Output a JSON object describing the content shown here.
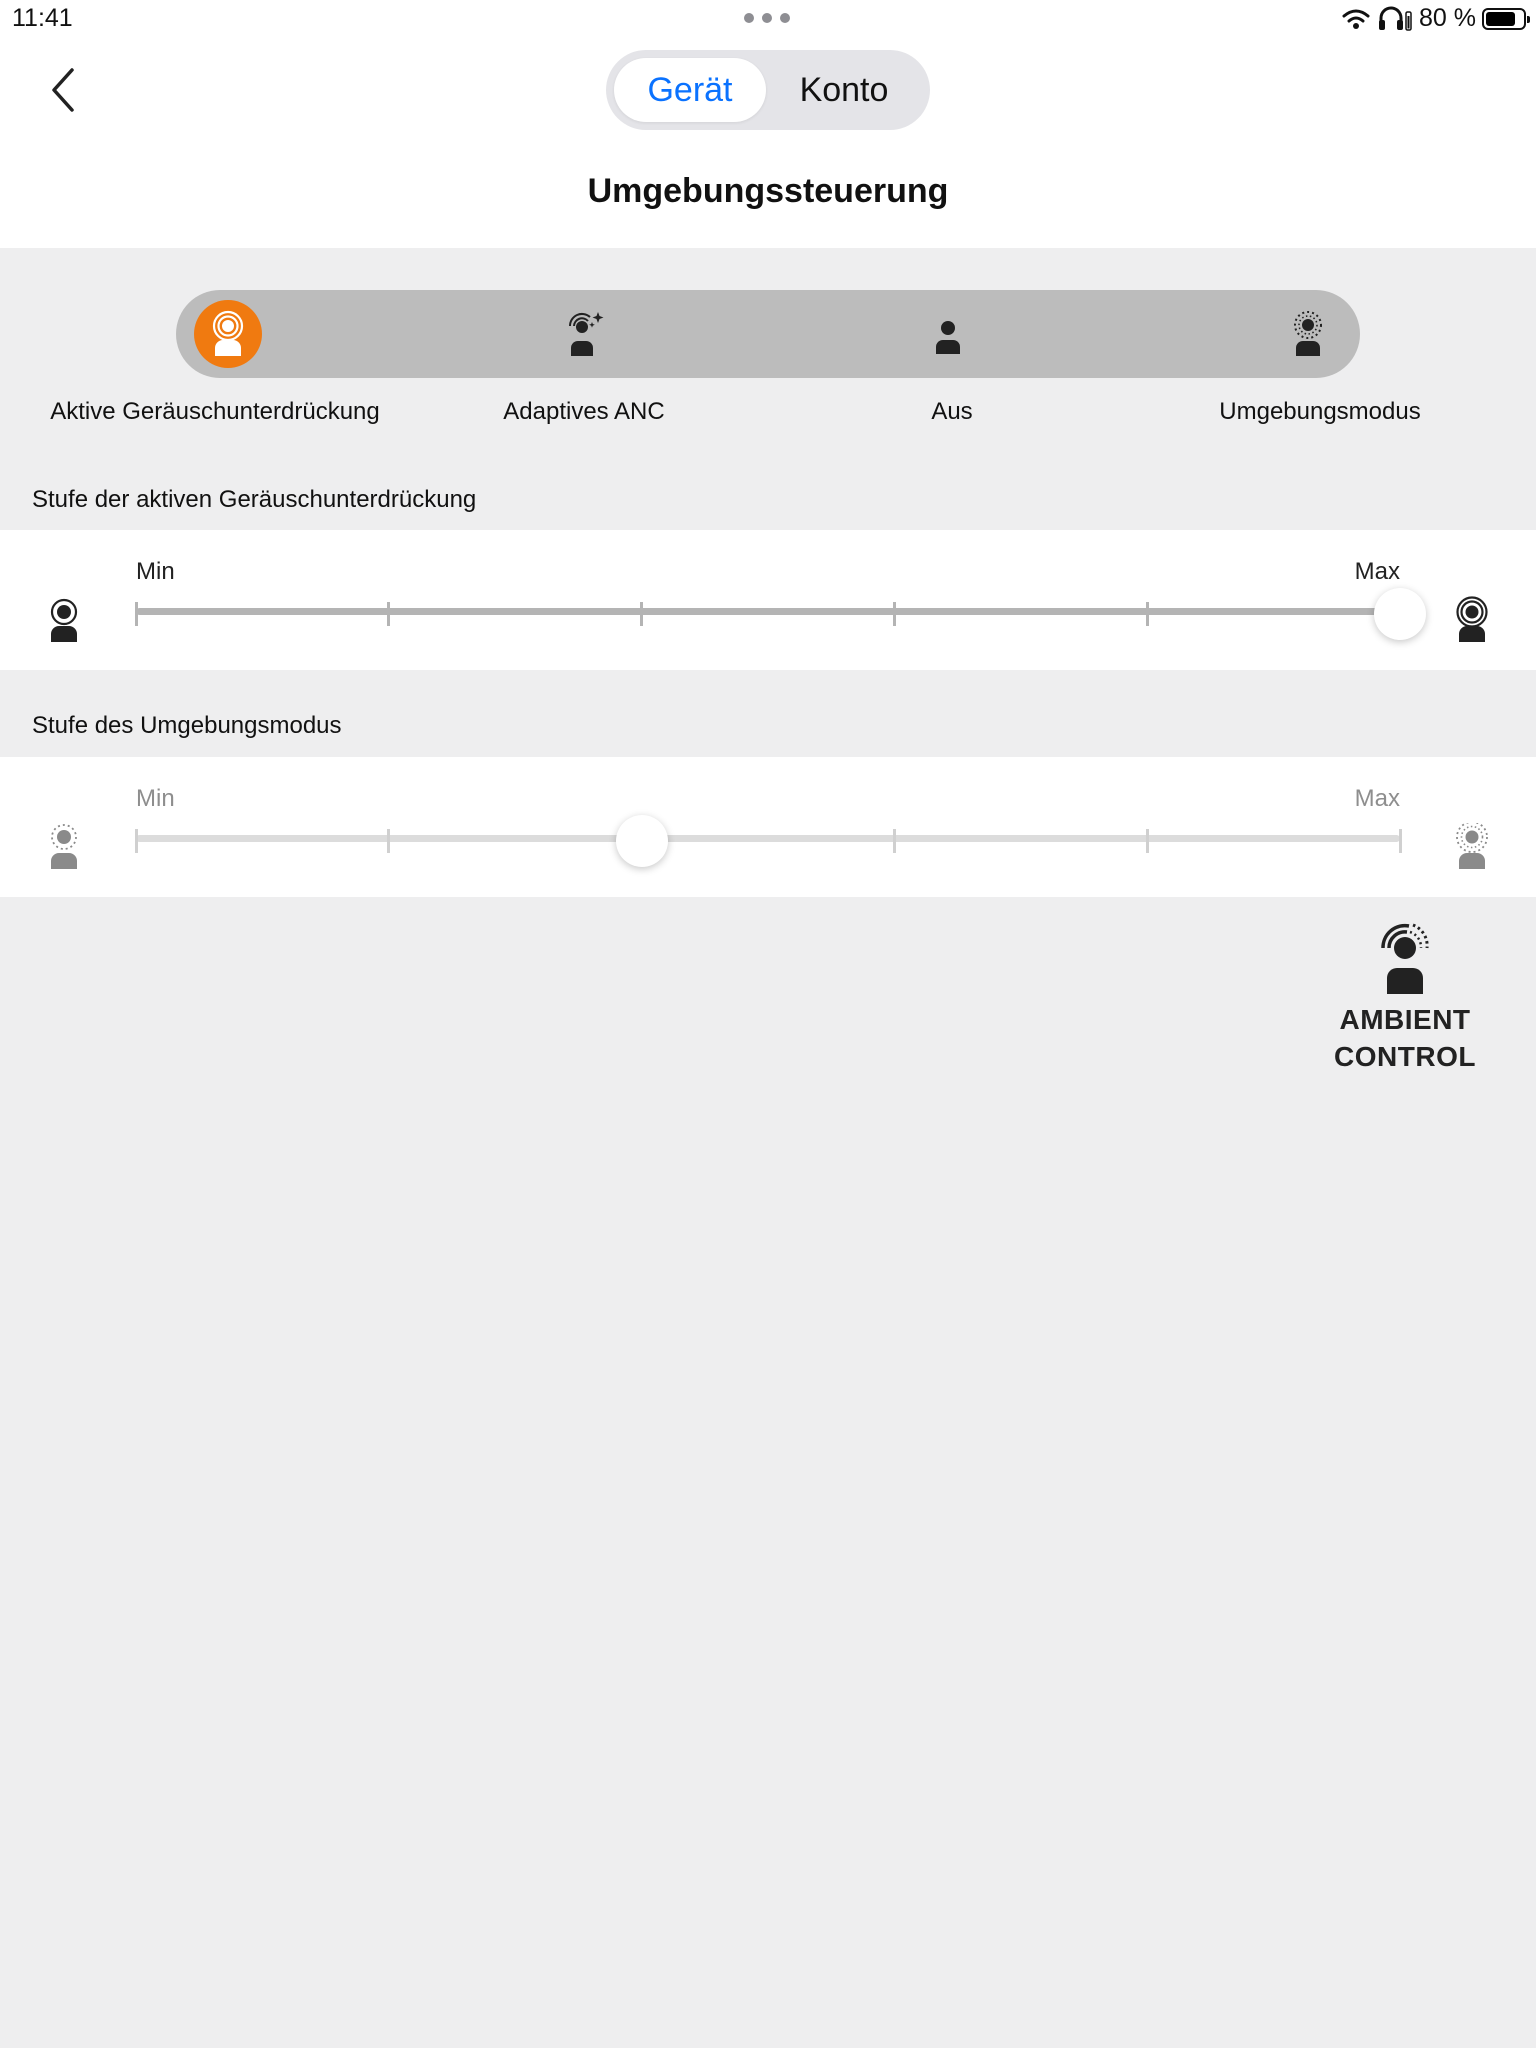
{
  "status_bar": {
    "time": "11:41",
    "battery_text": "80 %",
    "battery_level": 0.8
  },
  "header": {
    "tabs": [
      {
        "label": "Gerät",
        "active": true
      },
      {
        "label": "Konto",
        "active": false
      }
    ],
    "title": "Umgebungssteuerung"
  },
  "modes": {
    "selected_index": 0,
    "accent_color": "#f07a10",
    "items": [
      {
        "label": "Aktive Geräuschunterdrückung",
        "icon": "anc-icon"
      },
      {
        "label": "Adaptives ANC",
        "icon": "adaptive-anc-icon"
      },
      {
        "label": "Aus",
        "icon": "person-icon"
      },
      {
        "label": "Umgebungsmodus",
        "icon": "ambient-icon"
      }
    ]
  },
  "anc_level": {
    "label": "Stufe der aktiven Geräuschunterdrückung",
    "min_label": "Min",
    "max_label": "Max",
    "steps": 5,
    "value": 5,
    "enabled": true
  },
  "ambient_level": {
    "label": "Stufe des Umgebungsmodus",
    "min_label": "Min",
    "max_label": "Max",
    "steps": 5,
    "value": 2,
    "enabled": false
  },
  "logo": {
    "line1": "AMBIENT",
    "line2": "CONTROL"
  }
}
